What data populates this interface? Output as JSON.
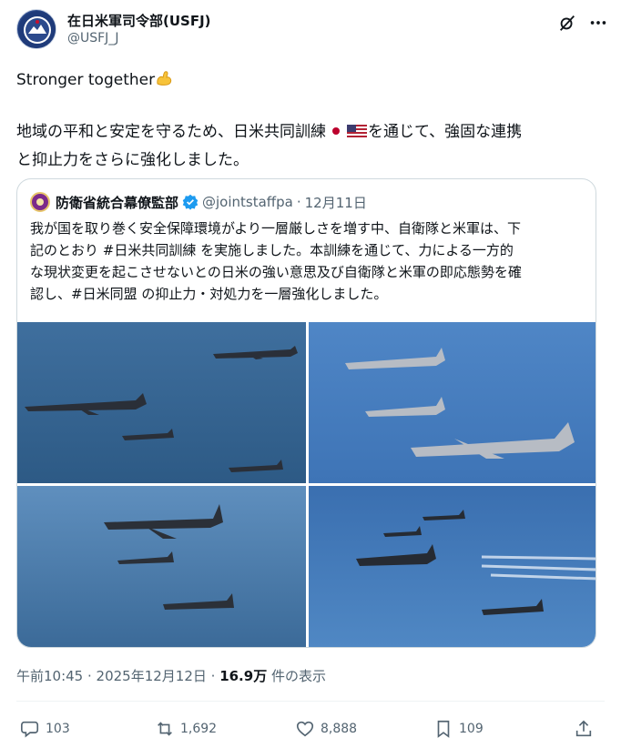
{
  "header": {
    "name": "在日米軍司令部(USFJ)",
    "handle": "@USFJ_J",
    "grok_icon": "grok-slash-icon",
    "more_icon": "more-horizontal-icon"
  },
  "post": {
    "line1": "Stronger together",
    "line1_emoji": "flexed-biceps",
    "line2_a": "地域の平和と安定を守るため、日米共同訓練",
    "line2_flags": [
      "japan-flag",
      "us-flag"
    ],
    "line2_b": "を通じて、強固な連携",
    "line3": "と抑止力をさらに強化しました。"
  },
  "quote": {
    "name": "防衛省統合幕僚監部",
    "handle": "@jointstaffpa",
    "separator": "·",
    "date": "12月11日",
    "text_1": "我が国を取り巻く安全保障環境がより一層厳しさを増す中、自衛隊と米軍は、下",
    "text_2": "記のとおり #日米共同訓練 を実施しました。本訓練を通じて、力による一方的",
    "text_3": "な現状変更を起こさせないとの日米の強い意思及び自衛隊と米軍の即応態勢を確",
    "text_4": "認し、#日米同盟 の抑止力・対処力を一層強化しました。",
    "photos": [
      "two B-52 bombers with three fighter jets over ocean",
      "four fighter jets escorting a B-52 bomber",
      "B-52 bomber with two fighter jets over sea",
      "bombers and fighters in formation with contrails"
    ]
  },
  "meta": {
    "time": "午前10:45 · 2025年12月12日 · ",
    "views": "16.9万",
    "views_suffix": " 件の表示"
  },
  "actions": {
    "replies": "103",
    "reposts": "1,692",
    "likes": "8,888",
    "bookmarks": "109"
  },
  "colors": {
    "text": "#0f1419",
    "secondary": "#536471",
    "border": "#cfd9de",
    "verified": "#1d9bf0"
  }
}
